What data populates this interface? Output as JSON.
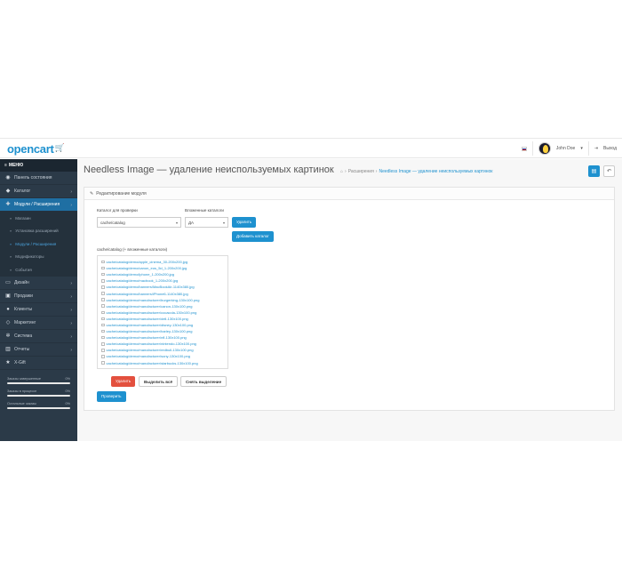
{
  "header": {
    "logo": "opencart",
    "user_name": "John Doe",
    "logout_label": "Выход"
  },
  "sidebar": {
    "menu_label": "МЕНЮ",
    "items": [
      {
        "label": "Панель состояния",
        "icon": "dashboard-icon",
        "arrow": false
      },
      {
        "label": "Каталог",
        "icon": "tag-icon",
        "arrow": true
      },
      {
        "label": "Модули / Расширения",
        "icon": "puzzle-icon",
        "arrow": true,
        "active": true
      },
      {
        "label": "Дизайн",
        "icon": "monitor-icon",
        "arrow": true
      },
      {
        "label": "Продажи",
        "icon": "cart-icon",
        "arrow": true
      },
      {
        "label": "Клиенты",
        "icon": "user-icon",
        "arrow": true
      },
      {
        "label": "Маркетинг",
        "icon": "share-icon",
        "arrow": true
      },
      {
        "label": "Система",
        "icon": "gear-icon",
        "arrow": true
      },
      {
        "label": "Отчеты",
        "icon": "chart-icon",
        "arrow": true
      },
      {
        "label": "X-Gift",
        "icon": "star-icon",
        "arrow": false
      }
    ],
    "subitems": [
      {
        "label": "Магазин"
      },
      {
        "label": "Установка расширений"
      },
      {
        "label": "Модули / Расширения",
        "current": true
      },
      {
        "label": "Модификаторы"
      },
      {
        "label": "События"
      }
    ],
    "stats": [
      {
        "label": "Заказы завершенные",
        "value": "0%"
      },
      {
        "label": "Заказы в процессе",
        "value": "0%"
      },
      {
        "label": "Остальные заказы",
        "value": "0%"
      }
    ]
  },
  "page": {
    "title": "Needless Image — удаление неиспользуемых картинок",
    "breadcrumb": [
      "Расширения",
      "Needless Image — удаление неиспользуемых картинок"
    ],
    "panel_title": "Редактирование модуля"
  },
  "form": {
    "catalog_label": "Каталог для проверки",
    "catalog_value": "cache/catalog",
    "nested_label": "Вложенные каталоги",
    "nested_value": "ДА",
    "delete_small_label": "Удалить",
    "add_catalog_label": "Добавить каталог",
    "list_caption": "cache/catalog (+ вложенные каталоги)",
    "files": [
      "cache/catalog/demo/apple_cinema_30-200x200.jpg",
      "cache/catalog/demo/canon_eos_5d_1-200x200.jpg",
      "cache/catalog/demo/iphone_1-200x200.jpg",
      "cache/catalog/demo/macbook_1-200x200.jpg",
      "cache/catalog/demo/banners/MacBookAir-1140x380.jpg",
      "cache/catalog/demo/banners/iPhone6-1140x380.jpg",
      "cache/catalog/demo/manufacturer/burgerking-130x100.png",
      "cache/catalog/demo/manufacturer/canon-130x100.png",
      "cache/catalog/demo/manufacturer/cocacola-130x100.png",
      "cache/catalog/demo/manufacturer/dell-130x100.png",
      "cache/catalog/demo/manufacturer/disney-130x100.png",
      "cache/catalog/demo/manufacturer/harley-130x100.png",
      "cache/catalog/demo/manufacturer/nfl-130x100.png",
      "cache/catalog/demo/manufacturer/nintendo-130x100.png",
      "cache/catalog/demo/manufacturer/redbull-130x100.png",
      "cache/catalog/demo/manufacturer/sony-130x100.png",
      "cache/catalog/demo/manufacturer/starbucks-130x100.png"
    ],
    "delete_label": "Удалить",
    "select_all_label": "Выделить всё",
    "deselect_label": "Снять выделение",
    "check_label": "Проверить"
  },
  "colors": {
    "accent": "#1e91cf",
    "sidebar_bg": "#2b3a48",
    "danger": "#e3503e"
  }
}
